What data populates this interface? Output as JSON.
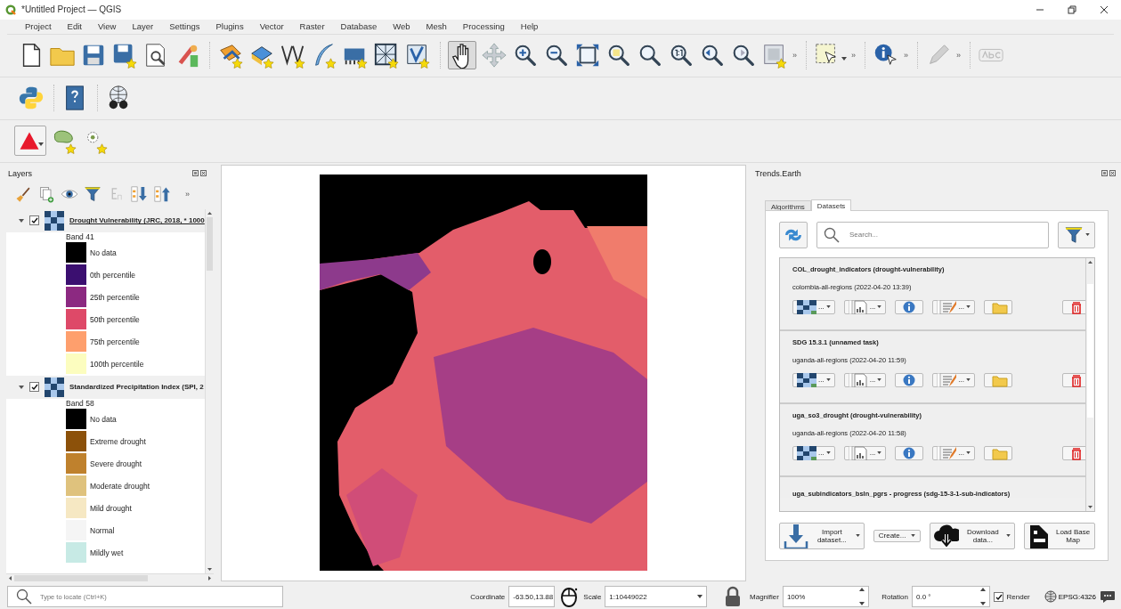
{
  "window": {
    "title": "*Untitled Project — QGIS"
  },
  "menu": [
    "Project",
    "Edit",
    "View",
    "Layer",
    "Settings",
    "Plugins",
    "Vector",
    "Raster",
    "Database",
    "Web",
    "Mesh",
    "Processing",
    "Help"
  ],
  "toolbar": {
    "more": [
      "»",
      "»",
      "»",
      "»"
    ]
  },
  "layers_panel": {
    "title": "Layers",
    "more": "»",
    "layers": [
      {
        "name": "Drought Vulnerability (JRC, 2018, * 1000",
        "selected": true,
        "checked": true,
        "expanded": true,
        "band": "Band 41",
        "legend": [
          {
            "label": "No data",
            "color": "#000000"
          },
          {
            "label": "0th percentile",
            "color": "#3b0f70"
          },
          {
            "label": "25th percentile",
            "color": "#8c2981"
          },
          {
            "label": "50th percentile",
            "color": "#de4968"
          },
          {
            "label": "75th percentile",
            "color": "#fe9f6d"
          },
          {
            "label": "100th percentile",
            "color": "#fcfdbf"
          }
        ]
      },
      {
        "name": "Standardized Precipitation Index (SPI, 2",
        "selected": false,
        "checked": true,
        "expanded": true,
        "band": "Band 58",
        "legend": [
          {
            "label": "No data",
            "color": "#000000"
          },
          {
            "label": "Extreme drought",
            "color": "#8c510a"
          },
          {
            "label": "Severe drought",
            "color": "#bf812d"
          },
          {
            "label": "Moderate drought",
            "color": "#dfc27d"
          },
          {
            "label": "Mild drought",
            "color": "#f6e8c3"
          },
          {
            "label": "Normal",
            "color": "#f5f5f5"
          },
          {
            "label": "Mildly wet",
            "color": "#c7eae5"
          }
        ]
      }
    ]
  },
  "trends_panel": {
    "title": "Trends.Earth",
    "tabs": [
      {
        "label": "Algorithms",
        "selected": false
      },
      {
        "label": "Datasets",
        "selected": true
      }
    ],
    "search": {
      "placeholder": "Search..."
    },
    "datasets": [
      {
        "name": "COL_drought_indicators (drought-vulnerability)",
        "detail": "colombia-all-regions (2022-04-20 13:39)",
        "actions": [
          {
            "kind": "load",
            "more": "..."
          },
          {
            "kind": "report",
            "more": "..."
          },
          {
            "kind": "info"
          },
          {
            "kind": "edit",
            "more": "..."
          },
          {
            "kind": "folder"
          },
          {
            "kind": "delete"
          }
        ]
      },
      {
        "name": "SDG 15.3.1 (unnamed task)",
        "detail": "uganda-all-regions (2022-04-20 11:59)",
        "actions": [
          {
            "kind": "load",
            "more": "..."
          },
          {
            "kind": "report",
            "more": "..."
          },
          {
            "kind": "info"
          },
          {
            "kind": "edit",
            "more": "..."
          },
          {
            "kind": "folder"
          },
          {
            "kind": "delete"
          }
        ]
      },
      {
        "name": "uga_so3_drought (drought-vulnerability)",
        "detail": "uganda-all-regions (2022-04-20 11:58)",
        "actions": [
          {
            "kind": "load",
            "more": "..."
          },
          {
            "kind": "report",
            "more": "..."
          },
          {
            "kind": "info"
          },
          {
            "kind": "edit",
            "more": "..."
          },
          {
            "kind": "folder"
          },
          {
            "kind": "delete"
          }
        ]
      },
      {
        "name": "uga_subindicators_bsln_pgrs - progress (sdg-15-3-1-sub-indicators)"
      }
    ],
    "buttons": [
      {
        "kind": "import",
        "label": "Import dataset..."
      },
      {
        "kind": "create",
        "label": "Create..."
      },
      {
        "kind": "download",
        "label": "Download data..."
      },
      {
        "kind": "basemap",
        "label": "Load Base Map"
      }
    ]
  },
  "status_bar": {
    "locate_placeholder": "Type to locate (Ctrl+K)",
    "coordinate_label": "Coordinate",
    "coordinate": "-63.50,13.88",
    "scale_label": "Scale",
    "scale": "1:10449022",
    "magnifier_label": "Magnifier",
    "magnifier": "100%",
    "rotation_label": "Rotation",
    "rotation": "0.0 °",
    "render": {
      "label": "Render",
      "checked": true
    },
    "crs": "EPSG:4326"
  }
}
